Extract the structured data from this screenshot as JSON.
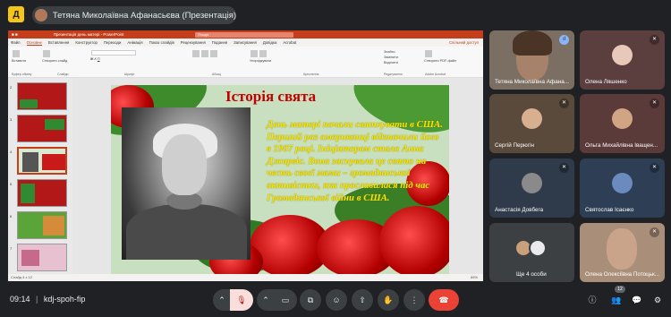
{
  "meeting": {
    "app_icon_letter": "Д",
    "presenter_chip": "Тетяна Миколаївна Афанасьєва (Презентація)",
    "time": "09:14",
    "divider": "|",
    "code": "kdj-spoh-fip",
    "participants_count": "12"
  },
  "powerpoint": {
    "file_name": "Презентація день матері - PowerPoint",
    "search_placeholder": "Пошук",
    "tabs": [
      "Файл",
      "Основне",
      "Вставлення",
      "Конструктор",
      "Переходи",
      "Анімація",
      "Показ слайдів",
      "Рецензування",
      "Подання",
      "Записування",
      "Довідка",
      "Acrobat"
    ],
    "active_tab": "Основне",
    "share_label": "Спільний доступ",
    "groups": [
      "Буфер обміну",
      "Слайди",
      "Шрифт",
      "Абзац",
      "Креслення",
      "Редагування",
      "Adobe Acrobat"
    ],
    "buttons": {
      "paste": "Вставити",
      "new_slide": "Створити слайд",
      "arrange": "Упорядкувати",
      "find": "Знайти",
      "replace": "Замінити",
      "select": "Виділити",
      "create_pdf": "Створити PDF-файл"
    },
    "status_left": "Слайд 4 з 12",
    "zoom": "65%"
  },
  "slide": {
    "title": "Історія свята",
    "body": "День матері почали святкувати в США. Перший раз американці відзначили його в 1907 році. Ініціатором стала Анна Джарвіс. Вона заснувала це свято на честь своєї мами – громадянської активістки, яка прославилася під час Громадянської війни в США."
  },
  "thumbs": [
    {
      "num": "2"
    },
    {
      "num": "3"
    },
    {
      "num": "4",
      "selected": true
    },
    {
      "num": "5"
    },
    {
      "num": "6"
    },
    {
      "num": "7"
    }
  ],
  "participants": [
    {
      "name": "Тетяна Миколаївна Афана...",
      "mic": "speaking",
      "avatar_color": "#a7826a"
    },
    {
      "name": "Олена Ляшенко",
      "mic": "off",
      "avatar_color": "#e8c8b8"
    },
    {
      "name": "Сергій Перюгін",
      "mic": "off",
      "avatar_color": "#d9b08f"
    },
    {
      "name": "Ольга Михайлівна Іващен...",
      "mic": "off",
      "avatar_color": "#d1a583"
    },
    {
      "name": "Анастасія Довбега",
      "mic": "off",
      "avatar_color": "#8a8a8a"
    },
    {
      "name": "Святослав Ісаєнко",
      "mic": "off",
      "avatar_color": "#6b8bbf"
    },
    {
      "name": "Ще 4 особи",
      "mic": "none",
      "avatar_color": "#9aa0a6"
    },
    {
      "name": "Олена Олексіївна Потоцьк...",
      "mic": "off",
      "avatar_color": "#c9a38a"
    }
  ],
  "controls": {
    "mic_icon": "mic-off-icon",
    "camera_icon": "camera-icon",
    "captions_icon": "captions-icon",
    "emoji_icon": "emoji-icon",
    "present_icon": "present-icon",
    "more_icon": "more-icon",
    "hand_icon": "raise-hand-icon",
    "end_icon": "end-call-icon"
  },
  "colors": {
    "end_call": "#ea4335",
    "mic_off": "#f9dedc",
    "ppt_accent": "#c43e1c",
    "slide_title": "#c00000",
    "slide_text": "#f4e800"
  }
}
